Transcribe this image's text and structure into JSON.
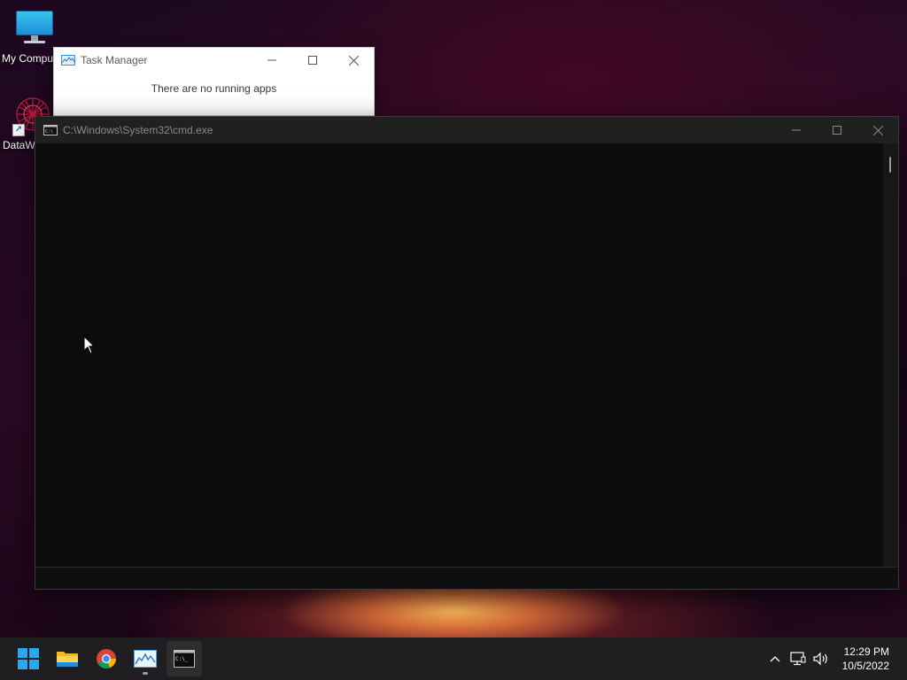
{
  "desktop": {
    "icons": [
      {
        "label": "My Compu",
        "icon": "computer-icon"
      },
      {
        "label": "DataW",
        "icon": "datawrapper-icon"
      }
    ]
  },
  "task_manager": {
    "title": "Task Manager",
    "message": "There are no running apps"
  },
  "cmd": {
    "title": "C:\\Windows\\System32\\cmd.exe",
    "content": ""
  },
  "taskbar": {
    "apps": [
      {
        "name": "start",
        "icon": "windows-start-icon"
      },
      {
        "name": "file-explorer",
        "icon": "folder-icon"
      },
      {
        "name": "chrome",
        "icon": "chrome-icon"
      },
      {
        "name": "task-manager",
        "icon": "task-manager-icon"
      },
      {
        "name": "cmd",
        "icon": "cmd-icon"
      }
    ],
    "tray": {
      "time": "12:29 PM",
      "date": "10/5/2022"
    }
  },
  "colors": {
    "accent": "#0078d4",
    "taskbar_bg": "#1f1f22",
    "cmd_bg": "#0c0c0c"
  }
}
